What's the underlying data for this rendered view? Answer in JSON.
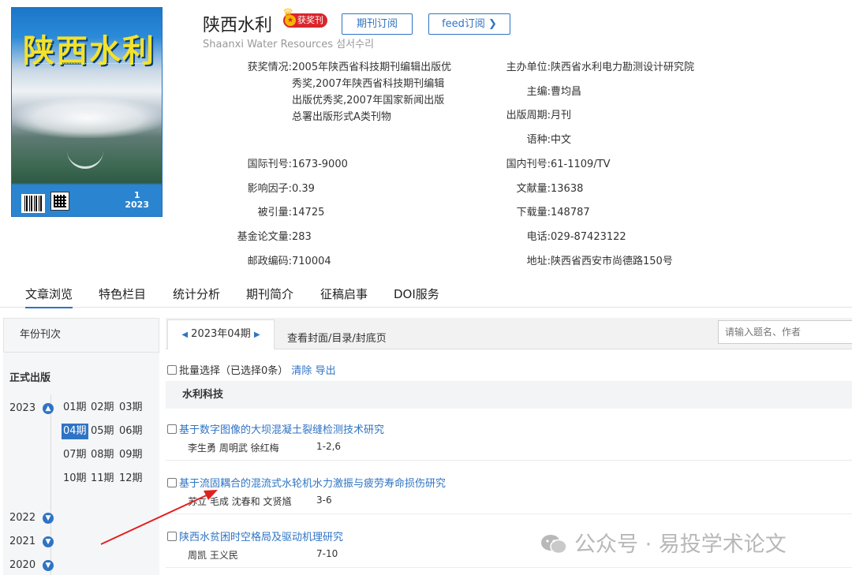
{
  "cover": {
    "title": "陕西水利",
    "issue_number": "1",
    "issue_year": "2023"
  },
  "journal": {
    "title_cn": "陕西水利",
    "award_badge": "获奖刊",
    "title_en": "Shaanxi Water Resources 섬서수리",
    "subscribe_label": "期刊订阅",
    "feed_label": "feed订阅 ❯"
  },
  "info_left": [
    {
      "label": "获奖情况:",
      "value": "2005年陕西省科技期刊编辑出版优秀奖,2007年陕西省科技期刊编辑出版优秀奖,2007年国家新闻出版总署出版形式A类刊物"
    },
    {
      "label": "国际刊号:",
      "value": "1673-9000"
    },
    {
      "label": "影响因子:",
      "value": "0.39"
    },
    {
      "label": "被引量:",
      "value": "14725"
    },
    {
      "label": "基金论文量:",
      "value": "283"
    },
    {
      "label": "邮政编码:",
      "value": "710004"
    }
  ],
  "award_lines": [
    "2005年陕西省科技期刊编辑出版优",
    "秀奖,2007年陕西省科技期刊编辑",
    "出版优秀奖,2007年国家新闻出版",
    "总署出版形式A类刊物"
  ],
  "info_right": [
    {
      "label": "主办单位:",
      "value": "陕西省水利电力勘测设计研究院"
    },
    {
      "label": "主编:",
      "value": "曹均昌"
    },
    {
      "label": "出版周期:",
      "value": "月刊"
    },
    {
      "label": "语种:",
      "value": "中文"
    },
    {
      "label": "国内刊号:",
      "value": "61-1109/TV"
    },
    {
      "label": "文献量:",
      "value": "13638"
    },
    {
      "label": "下载量:",
      "value": "148787"
    },
    {
      "label": "电话:",
      "value": "029-87423122"
    },
    {
      "label": "地址:",
      "value": "陕西省西安市尚德路150号"
    }
  ],
  "nav": [
    "文章浏览",
    "特色栏目",
    "统计分析",
    "期刊简介",
    "征稿启事",
    "DOI服务"
  ],
  "sidebar": {
    "tab_label": "年份刊次",
    "section_label": "正式出版",
    "years": [
      "2023",
      "2022",
      "2021",
      "2020"
    ],
    "issues": [
      "01期",
      "02期",
      "03期",
      "04期",
      "05期",
      "06期",
      "07期",
      "08期",
      "09期",
      "10期",
      "11期",
      "12期"
    ],
    "active_issue": "04期"
  },
  "main": {
    "issue_tab": "2023年04期",
    "cover_link": "查看封面/目录/封底页",
    "search_placeholder": "请输入题名、作者",
    "batch_label": "批量选择（已选择0条）",
    "clear_label": "清除",
    "export_label": "导出",
    "section_title": "水利科技",
    "articles": [
      {
        "title": "基于数字图像的大坝混凝土裂缝检测技术研究",
        "authors": "李生勇 周明武 徐红梅",
        "pages": "1-2,6"
      },
      {
        "title": "基于流固耦合的混流式水轮机水力激振与疲劳寿命损伤研究",
        "authors": "苏立 毛成 沈春和 文贤馗",
        "pages": "3-6"
      },
      {
        "title": "陕西水贫困时空格局及驱动机理研究",
        "authors": "周凯 王义民",
        "pages": "7-10"
      }
    ]
  },
  "watermark": "公众号 · 易投学术论文",
  "colors": {
    "accent": "#2f74c4",
    "badge": "#d9262c",
    "arrow": "#e02020"
  }
}
